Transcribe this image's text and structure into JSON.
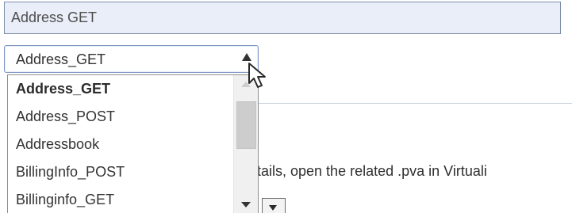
{
  "form": {
    "name_field": {
      "value": "Address GET"
    },
    "background_text": "tails, open the related .pva in Virtuali",
    "select": {
      "value": "Address_GET",
      "options": [
        "Address_GET",
        "Address_POST",
        "Addressbook",
        "BillingInfo_POST",
        "Billinginfo_GET"
      ],
      "selected_index": 0
    },
    "dropdown_scroll_fraction": 0.0,
    "icons": {
      "select_arrow": "up-triangle-icon",
      "scroll_up": "scroll-up-icon",
      "scroll_down": "scroll-down-icon",
      "background_select_arrow": "chevron-down-icon",
      "cursor": "mouse-pointer-icon"
    },
    "colors": {
      "field_background": "#e9eef8",
      "field_border": "#7f8fa8",
      "select_border": "#7d95c4",
      "dropdown_border": "#8e8e8e",
      "scrollbar_track": "#f0f0f0",
      "scrollbar_thumb": "#cdcdcd"
    }
  }
}
